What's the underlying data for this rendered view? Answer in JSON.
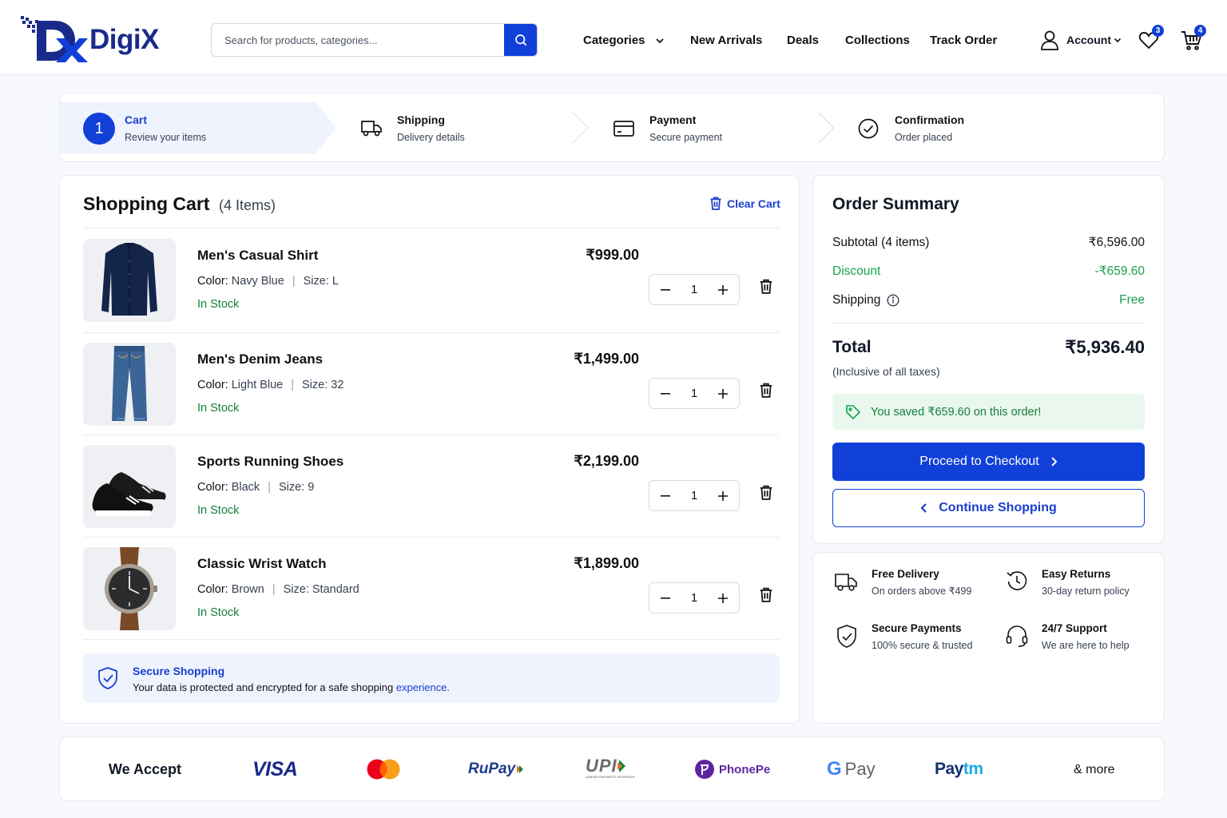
{
  "brand": {
    "name": "DigiX",
    "logo_letters": "DX"
  },
  "search": {
    "placeholder": "Search for products, categories..."
  },
  "nav": {
    "categories": "Categories",
    "new_arrivals": "New Arrivals",
    "deals": "Deals",
    "collections": "Collections",
    "track_order": "Track Order",
    "account": "Account",
    "wishlist_count": "3",
    "cart_count": "4"
  },
  "steps": [
    {
      "number": "1",
      "title": "Cart",
      "subtitle": "Review your items"
    },
    {
      "title": "Shipping",
      "subtitle": "Delivery details"
    },
    {
      "title": "Payment",
      "subtitle": "Secure payment"
    },
    {
      "title": "Confirmation",
      "subtitle": "Order placed"
    }
  ],
  "cart": {
    "title": "Shopping Cart",
    "count_label": "(4 Items)",
    "clear_label": "Clear Cart",
    "color_key": "Color:",
    "size_key": "Size:",
    "items": [
      {
        "name": "Men's Casual Shirt",
        "color": "Navy Blue",
        "size": "L",
        "stock": "In Stock",
        "price": "₹999.00",
        "qty": "1"
      },
      {
        "name": "Men's Denim Jeans",
        "color": "Light Blue",
        "size": "32",
        "stock": "In Stock",
        "price": "₹1,499.00",
        "qty": "1"
      },
      {
        "name": "Sports Running Shoes",
        "color": "Black",
        "size": "9",
        "stock": "In Stock",
        "price": "₹2,199.00",
        "qty": "1"
      },
      {
        "name": "Classic Wrist Watch",
        "color": "Brown",
        "size": "Standard",
        "stock": "In Stock",
        "price": "₹1,899.00",
        "qty": "1"
      }
    ],
    "secure": {
      "title": "Secure Shopping",
      "text": "Your data is protected and encrypted for a safe shopping",
      "link": "experience."
    }
  },
  "summary": {
    "title": "Order Summary",
    "subtotal_label": "Subtotal (4 items)",
    "subtotal_value": "₹6,596.00",
    "discount_label": "Discount",
    "discount_value": "-₹659.60",
    "shipping_label": "Shipping",
    "shipping_value": "Free",
    "total_label": "Total",
    "total_value": "₹5,936.40",
    "tax_note": "(Inclusive of all taxes)",
    "saved_text": "You saved ₹659.60 on this order!",
    "checkout_label": "Proceed to Checkout",
    "continue_label": "Continue Shopping"
  },
  "features": [
    {
      "title": "Free Delivery",
      "subtitle": "On orders above ₹499",
      "icon": "truck-icon"
    },
    {
      "title": "Easy Returns",
      "subtitle": "30-day return policy",
      "icon": "return-icon"
    },
    {
      "title": "Secure Payments",
      "subtitle": "100% secure & trusted",
      "icon": "shield-icon"
    },
    {
      "title": "24/7 Support",
      "subtitle": "We are here to help",
      "icon": "headset-icon"
    }
  ],
  "payments": {
    "label": "We Accept",
    "visa": "VISA",
    "rupay": "RuPay",
    "upi": "UPI",
    "upi_sub": "UNIFIED PAYMENTS INTERFACE",
    "phonepe": "PhonePe",
    "gpay_g": "G",
    "gpay": "Pay",
    "paytm_a": "Pay",
    "paytm_b": "tm",
    "more": "& more"
  },
  "colors": {
    "primary": "#1140d8",
    "brand": "#1a2a8c",
    "success": "#16a34a",
    "step_active_bg": "#eef3fe"
  }
}
